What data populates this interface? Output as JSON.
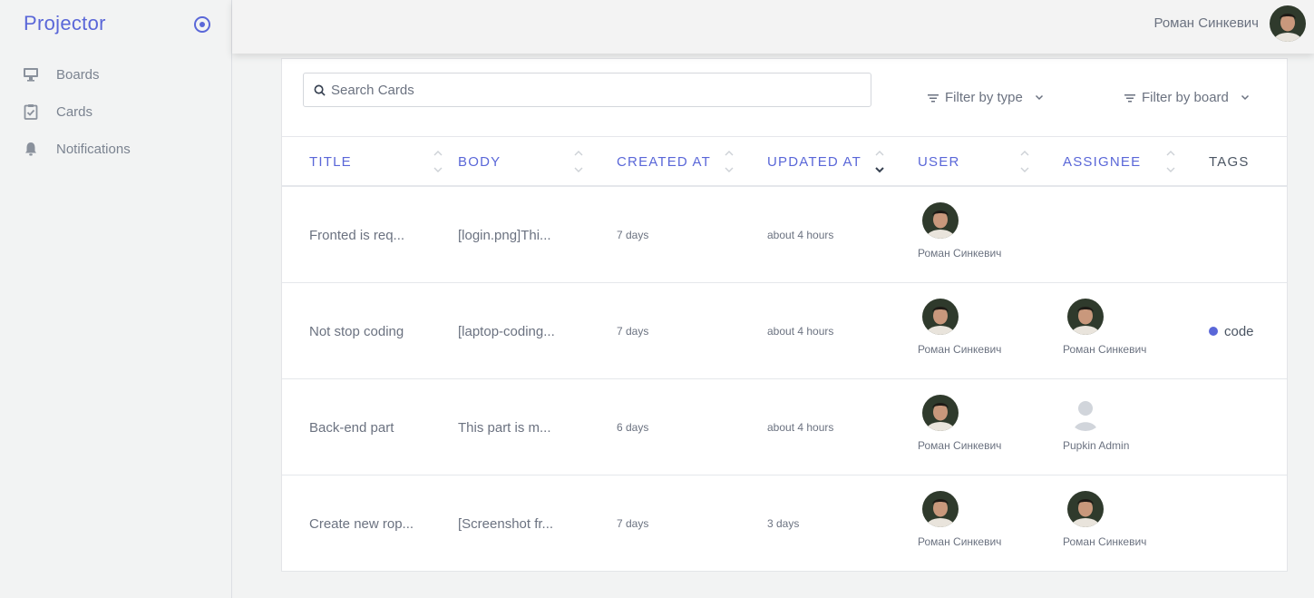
{
  "app": {
    "brand": "Projector"
  },
  "sidebar": {
    "items": [
      {
        "label": "Boards",
        "icon": "monitor-icon"
      },
      {
        "label": "Cards",
        "icon": "clipboard-check-icon"
      },
      {
        "label": "Notifications",
        "icon": "bell-icon"
      }
    ]
  },
  "header": {
    "user_name": "Роман Синкевич"
  },
  "toolbar": {
    "search_placeholder": "Search Cards",
    "filter_type": "Filter by type",
    "filter_board": "Filter by board"
  },
  "table": {
    "columns": [
      "TITLE",
      "BODY",
      "CREATED AT",
      "UPDATED AT",
      "USER",
      "ASSIGNEE",
      "TAGS"
    ],
    "sorted_column": "UPDATED AT",
    "sort_direction": "desc",
    "rows": [
      {
        "title": "Fronted is req...",
        "body": "[login.png]Thi...",
        "created": "7 days",
        "updated": "about 4 hours",
        "user": "Роман Синкевич",
        "assignee": "",
        "tag": ""
      },
      {
        "title": "Not stop coding",
        "body": "[laptop-coding...",
        "created": "7 days",
        "updated": "about 4 hours",
        "user": "Роман Синкевич",
        "assignee": "Роман Синкевич",
        "tag": "code"
      },
      {
        "title": "Back-end part",
        "body": "This part is m...",
        "created": "6 days",
        "updated": "about 4 hours",
        "user": "Роман Синкевич",
        "assignee": "Pupkin Admin",
        "tag": ""
      },
      {
        "title": "Create new rop...",
        "body": "[Screenshot fr...",
        "created": "7 days",
        "updated": "3 days",
        "user": "Роман Синкевич",
        "assignee": "Роман Синкевич",
        "tag": ""
      }
    ]
  },
  "colors": {
    "accent": "#5a67d8",
    "text": "#6b7280",
    "background": "#f2f3f3"
  }
}
